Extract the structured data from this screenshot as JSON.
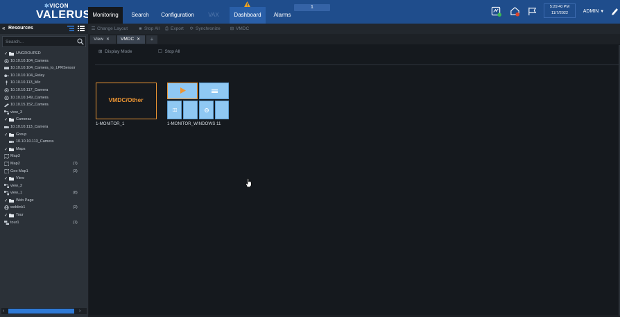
{
  "app": {
    "brand": "VICON",
    "product": "VALERUS"
  },
  "nav": {
    "items": [
      {
        "label": "Monitoring"
      },
      {
        "label": "Search"
      },
      {
        "label": "Configuration"
      },
      {
        "label": "VAX"
      },
      {
        "label": "Dashboard"
      },
      {
        "label": "Alarms"
      }
    ],
    "alarm_count": "1"
  },
  "header": {
    "time": "5:29:40 PM",
    "date": "11/7/2022",
    "user": "ADMIN",
    "notification_badge_color": "#e0452a"
  },
  "resources": {
    "title": "Resources",
    "search_placeholder": "Search...",
    "tree": [
      {
        "label": "UNGROUPED",
        "icon": "folder-icon",
        "count": ""
      },
      {
        "label": "10.10.10.104_Camera",
        "icon": "camera-icon",
        "count": ""
      },
      {
        "label": "10.10.10.104_Camera_to_LPRSensor",
        "icon": "lpr-sensor-icon",
        "count": ""
      },
      {
        "label": "10.10.10.104_Relay",
        "icon": "relay-icon",
        "count": ""
      },
      {
        "label": "10.10.10.113_Mic",
        "icon": "microphone-icon",
        "count": ""
      },
      {
        "label": "10.10.10.117_Camera",
        "icon": "camera-icon",
        "count": ""
      },
      {
        "label": "10.10.10.149_Camera",
        "icon": "camera-icon",
        "count": ""
      },
      {
        "label": "10.10.15.152_Camera",
        "icon": "bullet-camera-icon",
        "count": ""
      },
      {
        "label": "view_3",
        "icon": "view-icon",
        "count": ""
      },
      {
        "label": "Cameras",
        "icon": "folder-icon",
        "count": ""
      },
      {
        "label": "10.10.10.113_Camera",
        "icon": "box-camera-icon",
        "count": ""
      },
      {
        "label": "Group",
        "icon": "folder-icon",
        "count": ""
      },
      {
        "label": "10.10.10.113_Camera",
        "icon": "box-camera-icon",
        "count": ""
      },
      {
        "label": "Maps",
        "icon": "folder-icon",
        "count": ""
      },
      {
        "label": "Map3",
        "icon": "map-icon",
        "count": ""
      },
      {
        "label": "Map2",
        "icon": "map-icon",
        "count": "(7)"
      },
      {
        "label": "Geo Map1",
        "icon": "map-icon",
        "count": "(3)"
      },
      {
        "label": "View",
        "icon": "folder-icon",
        "count": ""
      },
      {
        "label": "view_2",
        "icon": "view-icon",
        "count": ""
      },
      {
        "label": "view_1",
        "icon": "view-icon",
        "count": "(8)"
      },
      {
        "label": "Web Page",
        "icon": "folder-icon",
        "count": ""
      },
      {
        "label": "weblink1",
        "icon": "globe-icon",
        "count": "(2)"
      },
      {
        "label": "Tour",
        "icon": "folder-icon",
        "count": ""
      },
      {
        "label": "tour1",
        "icon": "tour-icon",
        "count": "(1)"
      }
    ]
  },
  "toolbar": {
    "change_layout": "Change Layout",
    "stop_all": "Stop All",
    "export": "Export",
    "synchronize": "Synchronize",
    "vmdc": "VMDC"
  },
  "tabs": [
    {
      "label": "View"
    },
    {
      "label": "VMDC"
    }
  ],
  "workspace": {
    "display_mode": "Display Mode",
    "stop_all": "Stop All",
    "monitors": [
      {
        "thumb_text": "VMDC/Other",
        "label": "1-MONITOR_1"
      },
      {
        "thumb_text": "",
        "label": "1-MONITOR_WINDOWS 11"
      }
    ]
  },
  "colors": {
    "topbar": "#1f4d8c",
    "accent_orange": "#ec9533",
    "monitor_cell": "#8fc8f3",
    "active_tab": "#3a4350"
  }
}
